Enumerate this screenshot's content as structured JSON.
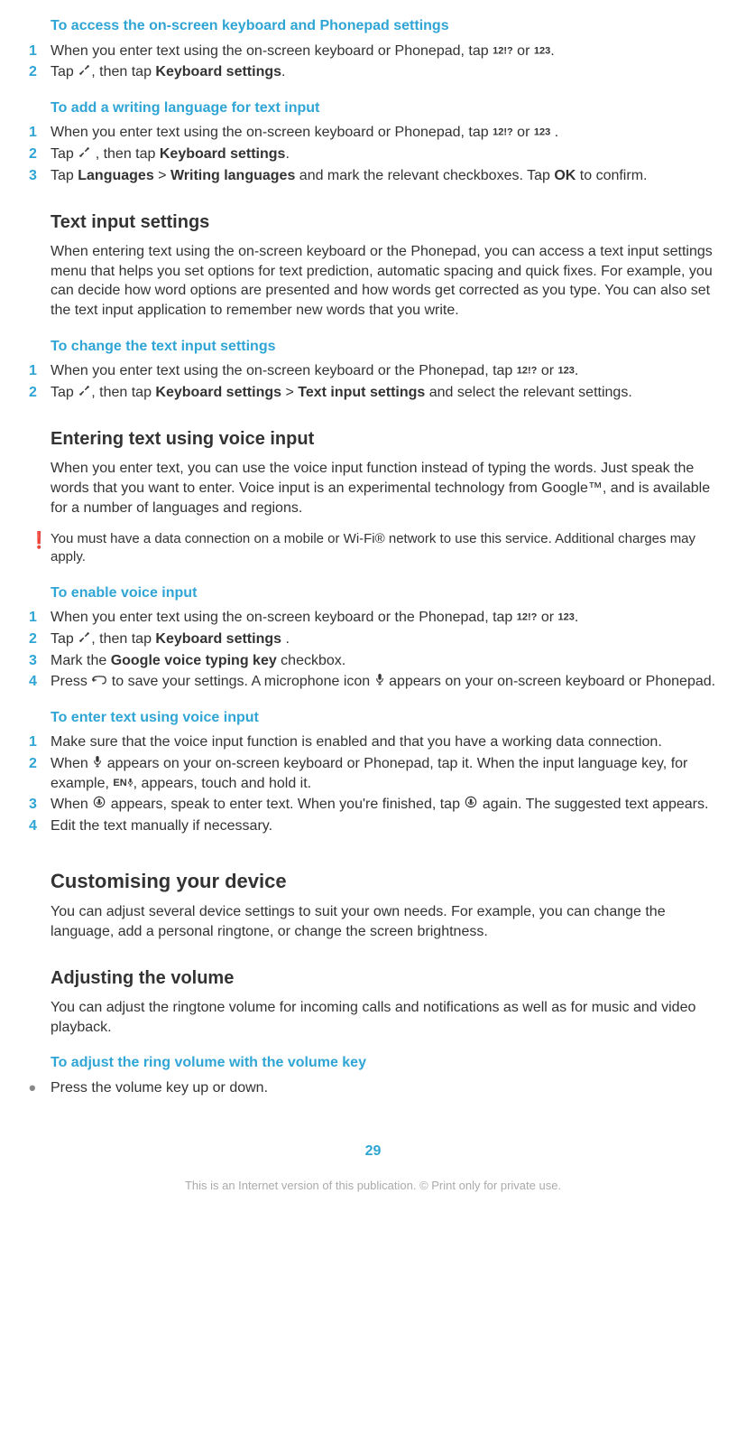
{
  "s1": {
    "title": "To access the on-screen keyboard and Phonepad settings",
    "step1": "When you enter text using the on-screen keyboard or Phonepad, tap ",
    "step1b": " or ",
    "step1c": ".",
    "step2a": "Tap ",
    "step2b": ", then tap ",
    "step2_kb": "Keyboard settings",
    "step2c": "."
  },
  "s2": {
    "title": "To add a writing language for text input",
    "step1": "When you enter text using the on-screen keyboard or Phonepad, tap ",
    "step1b": " or ",
    "step1c": " .",
    "step2a": "Tap ",
    "step2b": " , then tap ",
    "step2_kb": "Keyboard settings",
    "step2c": ".",
    "step3a": "Tap ",
    "step3_lang": "Languages",
    "step3b": " > ",
    "step3_wl": "Writing languages",
    "step3c": " and mark the relevant checkboxes. Tap ",
    "step3_ok": "OK",
    "step3d": " to confirm."
  },
  "tis": {
    "heading": "Text input settings",
    "body": "When entering text using the on-screen keyboard or the Phonepad, you can access a text input settings menu that helps you set options for text prediction, automatic spacing and quick fixes. For example, you can decide how word options are presented and how words get corrected as you type. You can also set the text input application to remember new words that you write."
  },
  "s3": {
    "title": "To change the text input settings",
    "step1": "When you enter text using the on-screen keyboard or the Phonepad, tap ",
    "step1b": " or ",
    "step1c": ".",
    "step2a": "Tap ",
    "step2b": ", then tap ",
    "step2_kb": "Keyboard settings",
    "step2c": " > ",
    "step2_tis": "Text input settings",
    "step2d": " and select the relevant settings."
  },
  "voice": {
    "heading": "Entering text using voice input",
    "body": "When you enter text, you can use the voice input function instead of typing the words. Just speak the words that you want to enter. Voice input is an experimental technology from Google™, and is available for a number of languages and regions.",
    "note": "You must have a data connection on a mobile or Wi-Fi® network to use this service. Additional charges may apply."
  },
  "s4": {
    "title": "To enable voice input",
    "step1": "When you enter text using the on-screen keyboard or the Phonepad, tap ",
    "step1b": " or ",
    "step1c": ".",
    "step2a": "Tap ",
    "step2b": ", then tap ",
    "step2_kb": "Keyboard settings",
    "step2c": " .",
    "step3a": "Mark the ",
    "step3_key": "Google voice typing key",
    "step3b": " checkbox.",
    "step4a": "Press ",
    "step4b": " to save your settings. A microphone icon ",
    "step4c": " appears on your on-screen keyboard or Phonepad."
  },
  "s5": {
    "title": "To enter text using voice input",
    "step1": "Make sure that the voice input function is enabled and that you have a working data connection.",
    "step2a": "When ",
    "step2b": " appears on your on-screen keyboard or Phonepad, tap it. When the input language key, for example, ",
    "step2c": ", appears, touch and hold it.",
    "step3a": "When ",
    "step3b": " appears, speak to enter text. When you're finished, tap ",
    "step3c": " again. The suggested text appears.",
    "step4": "Edit the text manually if necessary."
  },
  "custom": {
    "heading": "Customising your device",
    "body": "You can adjust several device settings to suit your own needs. For example, you can change the language, add a personal ringtone, or change the screen brightness."
  },
  "volume": {
    "heading": "Adjusting the volume",
    "body": "You can adjust the ringtone volume for incoming calls and notifications as well as for music and video playback."
  },
  "s6": {
    "title": "To adjust the ring volume with the volume key",
    "step1": "Press the volume key up or down."
  },
  "labels": {
    "k12": "12!?",
    "k123": "123",
    "en": "EN"
  },
  "pagenum": "29",
  "footer": "This is an Internet version of this publication. © Print only for private use."
}
